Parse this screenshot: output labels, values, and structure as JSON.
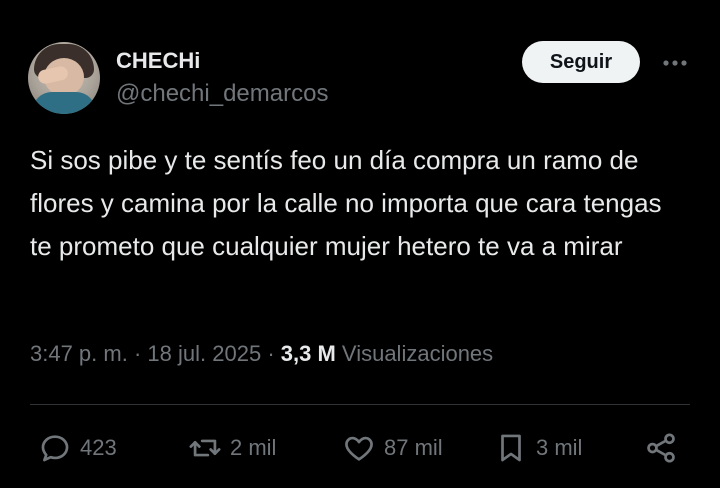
{
  "author": {
    "name": "CHECHi",
    "handle": "@chechi_demarcos"
  },
  "follow_label": "Seguir",
  "tweet": {
    "text": "Si sos pibe y te sentís feo un día compra un ramo de flores y camina por la calle no importa que cara tengas te prometo que cualquier mujer hetero te va a mirar"
  },
  "meta": {
    "time": "3:47 p. m.",
    "sep1": "·",
    "date": "18 jul. 2025",
    "sep2": "·",
    "views_count": "3,3 M",
    "views_label": "Visualizaciones"
  },
  "actions": {
    "replies": "423",
    "reposts": "2 mil",
    "likes": "87 mil",
    "bookmarks": "3 mil"
  },
  "colors": {
    "background": "#000000",
    "text": "#e7e9ea",
    "secondary": "#71767b",
    "follow_bg": "#eff3f4",
    "divider": "#2f3336"
  },
  "icons": {
    "more": "more-horizontal-icon",
    "reply": "reply-icon",
    "repost": "repost-icon",
    "like": "heart-icon",
    "bookmark": "bookmark-icon",
    "share": "share-icon"
  }
}
